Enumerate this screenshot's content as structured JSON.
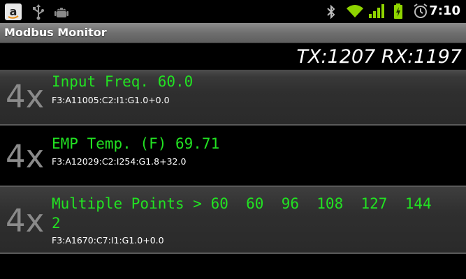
{
  "status_bar": {
    "time": "7:10",
    "left_icons": [
      "amazon-icon",
      "usb-icon",
      "android-debug-icon"
    ],
    "right_icons": [
      "bluetooth-icon",
      "wifi-icon",
      "signal-icon",
      "battery-charging-icon",
      "alarm-icon"
    ],
    "accent_color": "#8fd400"
  },
  "app": {
    "title": "Modbus Monitor"
  },
  "counters": {
    "text": "TX:1207 RX:1197"
  },
  "rows": [
    {
      "badge": "4x",
      "value": "Input Freq. 60.0",
      "address": "F3:A11005:C2:I1:G1.0+0.0"
    },
    {
      "badge": "4x",
      "value": "EMP Temp. (F) 69.71",
      "address": "F3:A12029:C2:I254:G1.8+32.0"
    },
    {
      "badge": "4x",
      "value_line1": "Multiple Points > 60  60  96  108  127  144",
      "value_line2": "2",
      "address": "F3:A1670:C7:I1:G1.0+0.0"
    }
  ]
}
